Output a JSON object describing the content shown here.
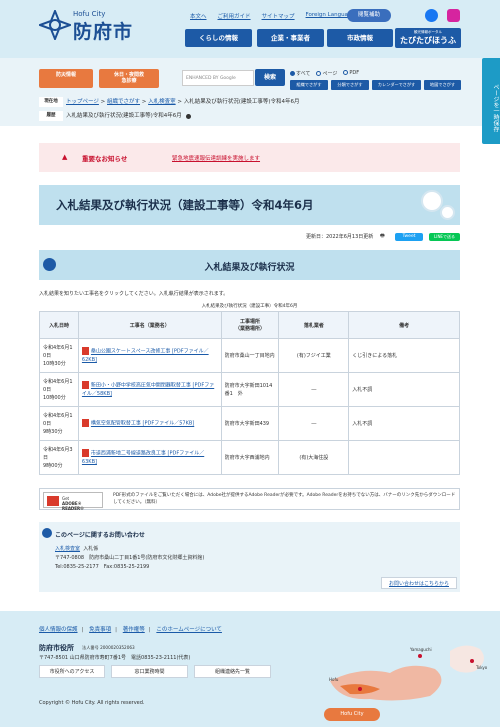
{
  "header": {
    "logo_small": "Hofu City",
    "logo_big": "防府市",
    "links": [
      "本文へ",
      "ご利用ガイド",
      "サイトマップ",
      "Foreign Language"
    ],
    "read_aloud": "閲覧補助",
    "main_nav": [
      "くらしの情報",
      "企業・事業者",
      "市政情報"
    ],
    "tourism_small": "観光情報ポータル",
    "tourism_big": "たびたびほうふ"
  },
  "util": {
    "disaster": "防災情報",
    "holiday": "休日・夜間救\n急診療",
    "search_placeholder": "ENHANCED BY Google",
    "search_button": "検索",
    "radio_all": "すべて",
    "radio_page": "ページ",
    "radio_pdf": "PDF",
    "sub_buttons": [
      "組織でさがす",
      "分類でさがす",
      "カレンダーでさがす",
      "地図でさがす"
    ],
    "current_label": "現在地",
    "breadcrumb": [
      "トップページ",
      "組織でさがす",
      "入札検査室"
    ],
    "breadcrumb_current": "入札結果及び執行状況(建設工事等)令和4年6月",
    "history_label": "履歴",
    "history_item": "入札結果及び執行状況(建設工事等)令和4年6月"
  },
  "notice": {
    "title": "重要なお知らせ",
    "link": "緊急地震速報伝達訓練を実施します"
  },
  "page": {
    "title": "入札結果及び執行状況（建設工事等）令和4年6月",
    "updated": "更新日：2022年6月13日更新",
    "print": "印刷",
    "tweet": "Tweet",
    "line": "LINEで送る",
    "section_title": "入札結果及び執行状況",
    "intro": "入札結果を知りたい工事名をクリックしてください。入札執行結果が表示されます。",
    "caption": "入札結果及び執行状況（建設工事）令和4年6月"
  },
  "table": {
    "headers": [
      "入札日時",
      "工事名（業務名）",
      "工事場所\n（業務場所）",
      "落札業者",
      "備考"
    ],
    "rows": [
      {
        "date": "令和4年6月1\n0日\n10時30分",
        "name": "桑山公園スケートスペース改修工事 [PDFファイル／62KB]",
        "place": "防府市桑山一丁目地内",
        "winner": "(有)フジイ工業",
        "note": "くじ引きによる落札"
      },
      {
        "date": "令和4年6月1\n0日\n10時00分",
        "name": "新田小・小野中学校高圧気中開閉器取替工事 [PDFファイル／58KB]",
        "place": "防府市大字新田1014番1　外",
        "winner": "―",
        "note": "入札不調"
      },
      {
        "date": "令和4年6月1\n0日\n9時30分",
        "name": "構気空気配管取替工事 [PDFファイル／57KB]",
        "place": "防府市大字新田439",
        "winner": "―",
        "note": "入札不調"
      },
      {
        "date": "令和4年6月3\n日\n9時00分",
        "name": "市道西浦新地二号線道路改良工事 [PDFファイル／63KB]",
        "place": "防府市大字西浦地内",
        "winner": "(有)大海住設",
        "note": ""
      }
    ]
  },
  "adobe": {
    "badge_small": "Get",
    "badge_big": "ADOBE® READER®",
    "text": "PDF形式のファイルをご覧いただく場合には、Adobe社が提供するAdobe Readerが必要です。Adobe Readerをお持ちでない方は、バナーのリンク先からダウンロードしてください。（無料）"
  },
  "contact": {
    "heading": "このページに関するお問い合わせ",
    "dept_link": "入札検査室",
    "dept_sub": "入札係",
    "address": "〒747-0808　防府市桑山二丁目1番1号(防府市文化財郷土資料館)",
    "phone": "Tel:0835-25-2177　Fax:0835-25-2199",
    "ask": "お問い合わせはこちらから"
  },
  "footer": {
    "links": [
      "個人情報の保護",
      "免責事項",
      "著作権等",
      "このホームページについて"
    ],
    "title": "防府市役所",
    "corp": "法人番号 2000020352063",
    "address": "〒747-8501 山口県防府市寿町7番1号　電話0835-23-2111(代表)",
    "buttons": [
      "市役所へのアクセス",
      "窓口業務時間",
      "組織連絡先一覧"
    ],
    "copyright": "Copyright © Hofu City. All rights reserved.",
    "badge": "Hofu City",
    "map_labels": [
      "Hofu",
      "Yamaguchi",
      "Tokyo"
    ]
  },
  "sidetab": "ページを一時保存",
  "colors": {
    "primary": "#1d5aa6",
    "accent": "#e8793f",
    "light_bg": "#d7ecf5",
    "alert": "#c8102e"
  }
}
